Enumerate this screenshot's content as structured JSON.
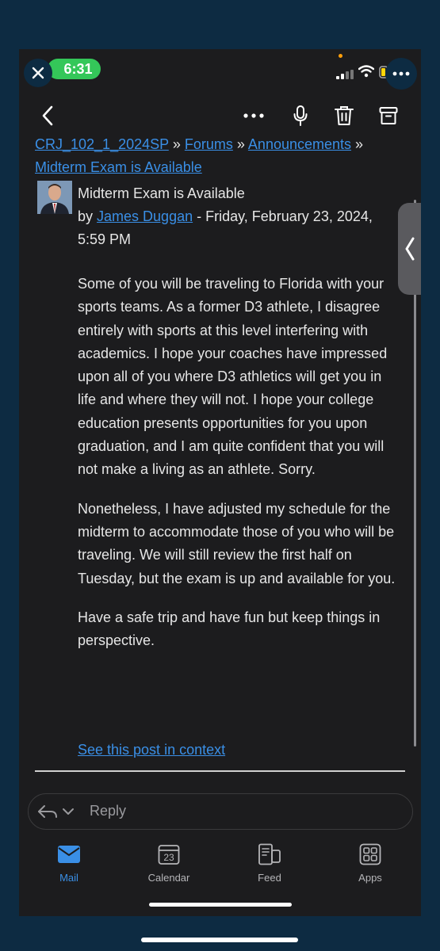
{
  "status": {
    "time": "6:31",
    "orange_dot_color": "#ff9f0a",
    "pill_color": "#34c759"
  },
  "toolbar": {
    "back": "chevron-left-icon",
    "more": "more-horizontal-icon",
    "mic": "microphone-icon",
    "delete": "trash-icon",
    "archive": "archive-icon"
  },
  "breadcrumb": {
    "course": "CRJ_102_1_2024SP",
    "sep": "»",
    "forums": "Forums",
    "announcements": "Announcements",
    "topic": "Midterm Exam is Available"
  },
  "post": {
    "title": "Midterm Exam is Available",
    "by": "by",
    "author": "James Duggan",
    "date": " - Friday, February 23, 2024, 5:59 PM",
    "paragraphs": [
      "Some of you will be traveling to Florida with your sports teams. As a former D3 athlete, I disagree entirely with sports at this level interfering with academics. I hope your coaches have impressed upon all of you where D3 athletics will get you in life and where they will not. I hope your college education presents opportunities for you upon graduation, and I am quite confident that you will not make a living as an athlete. Sorry.",
      "Nonetheless, I have adjusted my schedule for the midterm to accommodate those of you who will be traveling. We will still review the first half on Tuesday, but the exam is up and available for you.",
      "Have a safe trip and have fun but keep things in perspective."
    ],
    "context_link": "See this post in context"
  },
  "reply": {
    "label": "Reply"
  },
  "tabs": [
    {
      "label": "Mail",
      "icon": "mail-icon",
      "active": true
    },
    {
      "label": "Calendar",
      "icon": "calendar-icon",
      "day": "23"
    },
    {
      "label": "Feed",
      "icon": "feed-icon"
    },
    {
      "label": "Apps",
      "icon": "apps-icon"
    }
  ],
  "colors": {
    "link": "#3a8fe6",
    "background": "#1c1c1e",
    "frame": "#0d2b42"
  }
}
